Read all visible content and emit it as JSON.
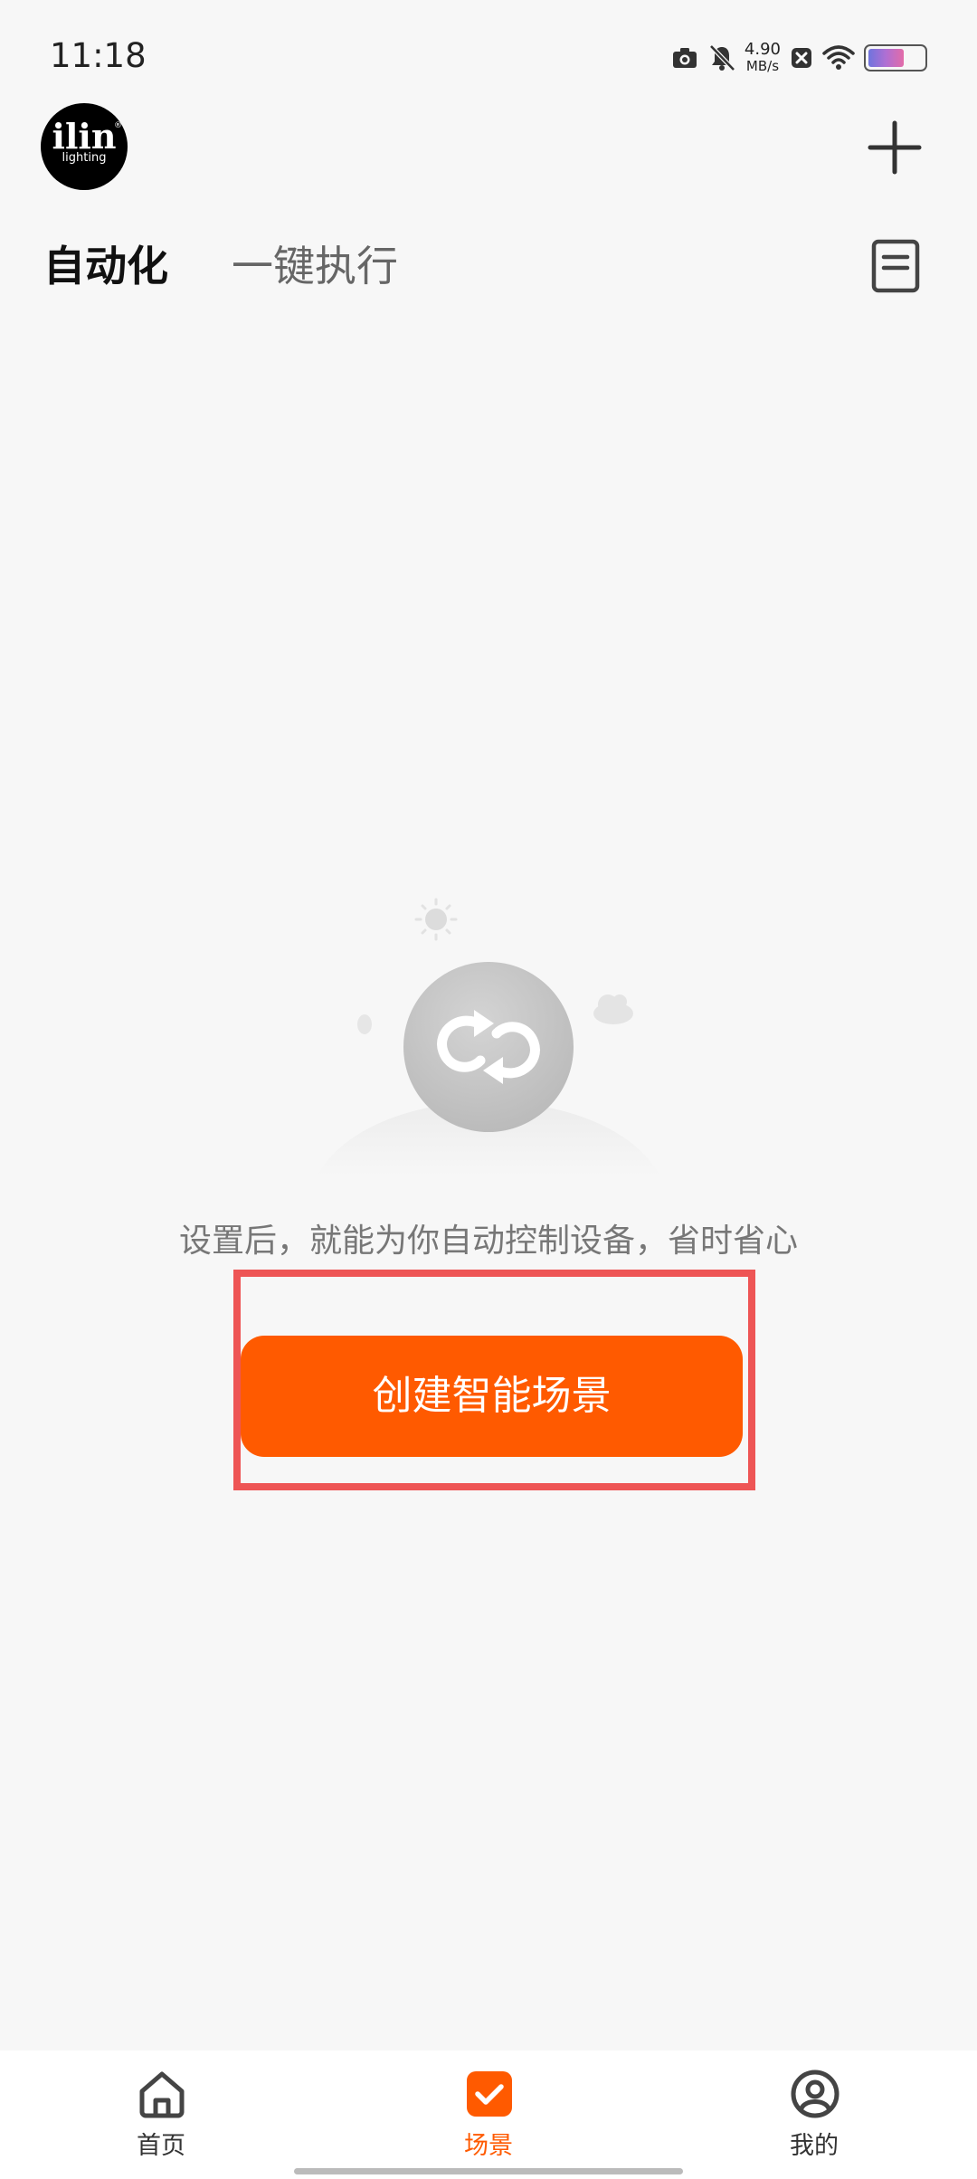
{
  "status_bar": {
    "time": "11:18",
    "net_speed_value": "4.90",
    "net_speed_unit": "MB/s",
    "battery_level": 0.65,
    "icons": [
      "camera-icon",
      "bell-muted-icon",
      "close-box-icon",
      "wifi-icon",
      "battery-icon"
    ]
  },
  "header": {
    "logo_text": "ilin",
    "logo_subtext": "lighting",
    "logo_mark": "®",
    "add_icon": "plus-icon",
    "log_icon": "document-icon"
  },
  "tabs": [
    {
      "label": "自动化",
      "active": true
    },
    {
      "label": "一键执行",
      "active": false
    }
  ],
  "empty_state": {
    "icon": "loop-sync-icon",
    "message": "设置后，就能为你自动控制设备，省时省心",
    "button_label": "创建智能场景"
  },
  "bottom_nav": {
    "items": [
      {
        "label": "首页",
        "icon": "home-icon",
        "active": false
      },
      {
        "label": "场景",
        "icon": "scene-check-icon",
        "active": true
      },
      {
        "label": "我的",
        "icon": "user-icon",
        "active": false
      }
    ]
  },
  "colors": {
    "accent": "#ff5a00",
    "highlight_border": "#ee5555",
    "background": "#f7f7f7"
  }
}
